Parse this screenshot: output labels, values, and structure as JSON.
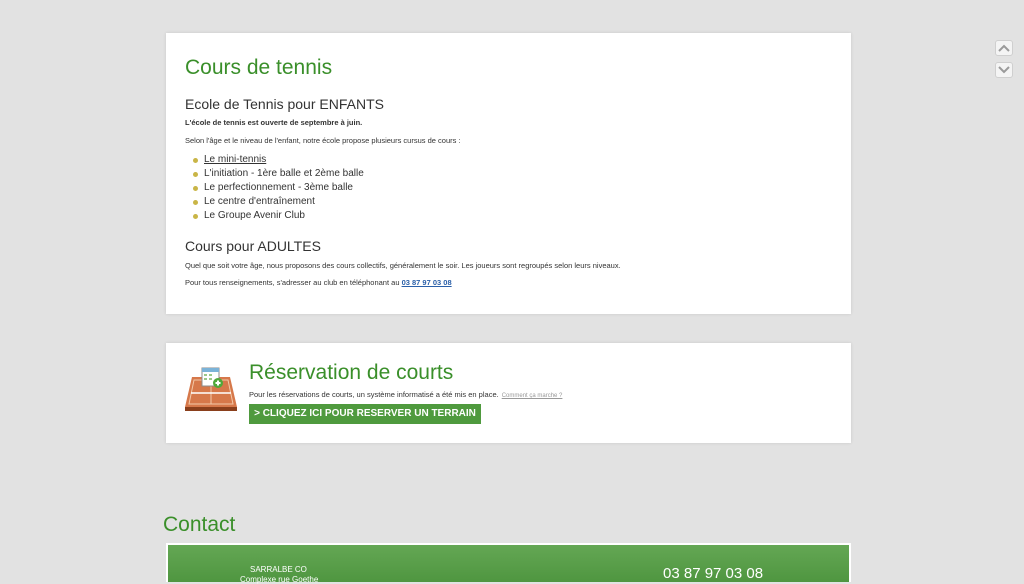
{
  "courses": {
    "title": "Cours de tennis",
    "kids": {
      "heading": "Ecole de Tennis pour ENFANTS",
      "intro_bold": "L'école de tennis est ouverte de septembre à juin.",
      "intro": "Selon l'âge et le niveau de l'enfant, notre école propose plusieurs cursus de cours :",
      "items": [
        "Le mini-tennis",
        "L'initiation - 1ère balle et 2ème balle",
        "Le perfectionnement - 3ème balle",
        "Le centre d'entraînement",
        "Le Groupe Avenir Club"
      ]
    },
    "adults": {
      "heading": "Cours pour ADULTES",
      "text": "Quel que soit votre âge, nous proposons des cours collectifs, généralement le soir. Les joueurs sont regroupés selon leurs niveaux.",
      "info_prefix": "Pour tous renseignements, s'adresser au club en téléphonant au ",
      "phone": "03 87 97 03 08"
    }
  },
  "booking": {
    "title": "Réservation de courts",
    "text": "Pour les réservations de courts, un système informatisé a été mis en place.",
    "help_link": "Comment ça marche ?",
    "button": "> CLIQUEZ ICI POUR RESERVER UN TERRAIN"
  },
  "contact": {
    "title": "Contact",
    "name": "SARRALBE CO",
    "address": "Complexe rue Goethe",
    "phone": "03 87 97 03 08"
  },
  "colors": {
    "accent_green": "#3a8f2a",
    "button_green": "#4f9a3e",
    "link_blue": "#2a5fa8",
    "bullet_gold": "#c9b547",
    "background": "#e2e2e2"
  },
  "icons": {
    "scroll_up": "chevron-up-icon",
    "scroll_down": "chevron-down-icon",
    "booking": "tennis-court-calendar-icon",
    "bullet": "bullet-dot-icon"
  }
}
